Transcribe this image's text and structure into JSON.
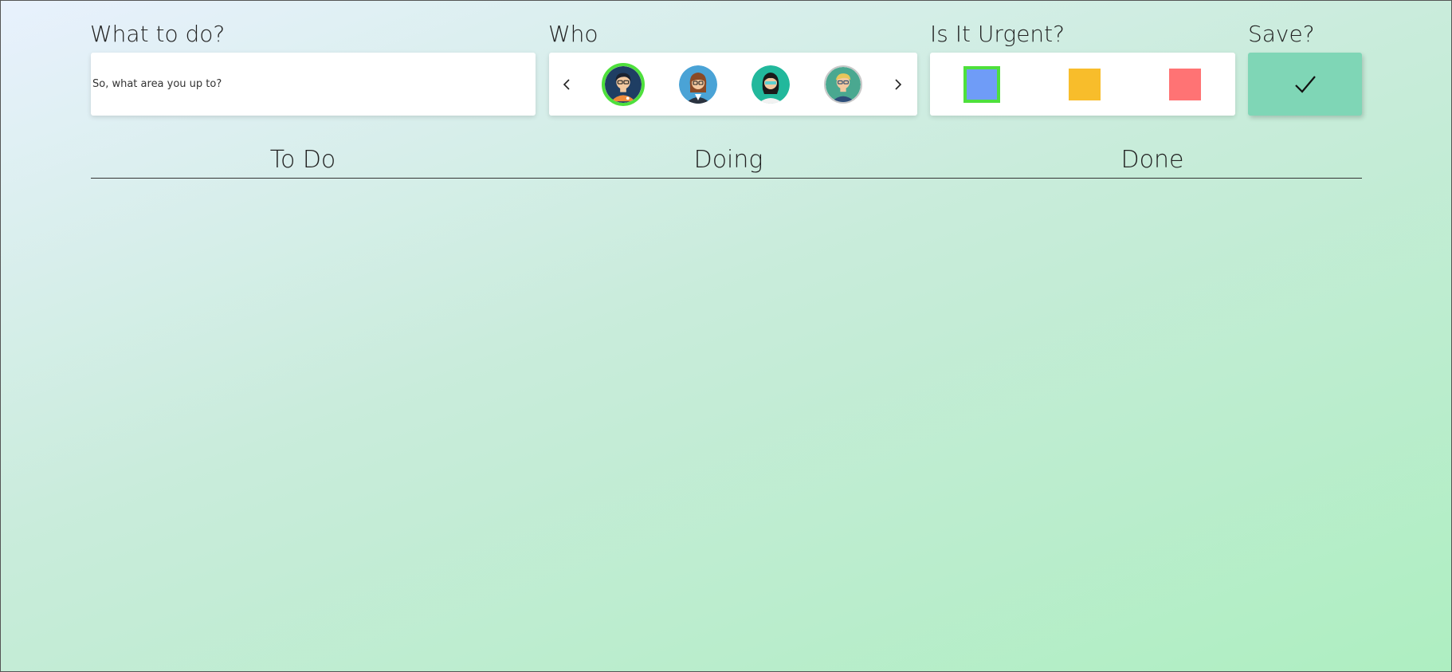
{
  "form": {
    "task": {
      "label": "What to do?",
      "placeholder": "So, what area you up to?",
      "value": ""
    },
    "who": {
      "label": "Who",
      "prev_icon": "chevron-left-icon",
      "next_icon": "chevron-right-icon",
      "avatars": [
        {
          "name": "avatar-1",
          "selected": true
        },
        {
          "name": "avatar-2",
          "selected": false
        },
        {
          "name": "avatar-3",
          "selected": false
        },
        {
          "name": "avatar-4",
          "selected": false
        }
      ]
    },
    "urgency": {
      "label": "Is It Urgent?",
      "options": [
        {
          "name": "blue",
          "color": "#6f9cf7",
          "selected": true
        },
        {
          "name": "yellow",
          "color": "#f8bd2b",
          "selected": false
        },
        {
          "name": "red",
          "color": "#ff7374",
          "selected": false
        }
      ],
      "selected_border_color": "#4ee03c"
    },
    "save": {
      "label": "Save?",
      "icon": "checkmark-icon",
      "color": "#7fd6b6"
    }
  },
  "board": {
    "columns": [
      {
        "title": "To Do"
      },
      {
        "title": "Doing"
      },
      {
        "title": "Done"
      }
    ]
  }
}
